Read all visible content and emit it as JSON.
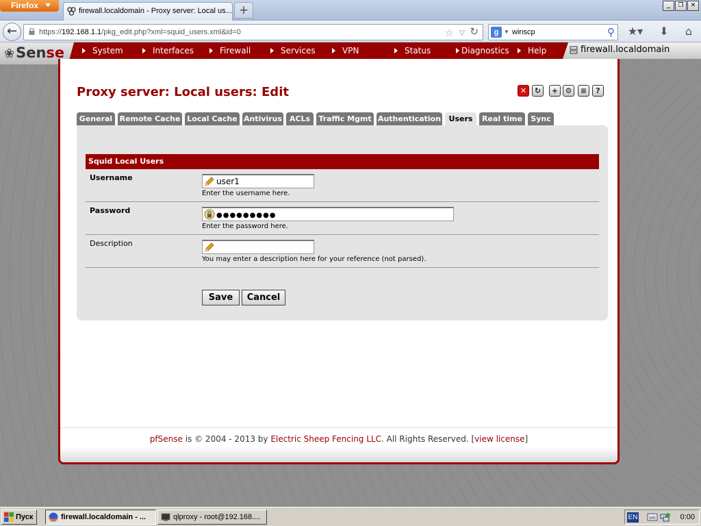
{
  "browser": {
    "menu_button": "Firefox",
    "tab_title": "firewall.localdomain - Proxy server: Local us...",
    "url_prefix": "https://",
    "url_host": "192.168.1.1",
    "url_path": "/pkg_edit.php?xml=squid_users.xml&id=0",
    "search_value": "winscp"
  },
  "pfsense": {
    "logo_text_left": "Sen",
    "logo_text_right": "se",
    "menu": [
      "System",
      "Interfaces",
      "Firewall",
      "Services",
      "VPN",
      "Status",
      "Diagnostics",
      "Help"
    ],
    "hostname": "firewall.localdomain"
  },
  "page": {
    "title": "Proxy server: Local users: Edit",
    "tabs": [
      "General",
      "Remote Cache",
      "Local Cache",
      "Antivirus",
      "ACLs",
      "Traffic Mgmt",
      "Authentication",
      "Users",
      "Real time",
      "Sync"
    ],
    "active_tab": "Users",
    "section_title": "Squid Local Users",
    "username": {
      "label": "Username",
      "value": "user1",
      "help": "Enter the username here."
    },
    "password": {
      "label": "Password",
      "value": "●●●●●●●●●",
      "help": "Enter the password here."
    },
    "description": {
      "label": "Description",
      "value": "",
      "help": "You may enter a description here for your reference (not parsed)."
    },
    "save_label": "Save",
    "cancel_label": "Cancel"
  },
  "footer": {
    "brand": "pfSense",
    "text_mid": " is © 2004 - 2013 by ",
    "company": "Electric Sheep Fencing LLC",
    "text_after": ". All Rights Reserved. [",
    "license_link": "view license",
    "text_end": "]"
  },
  "taskbar": {
    "start_label": "Пуск",
    "tasks": [
      "firewall.localdomain - ...",
      "qlproxy - root@192.168...."
    ],
    "lang": "EN",
    "clock": "0:00"
  }
}
